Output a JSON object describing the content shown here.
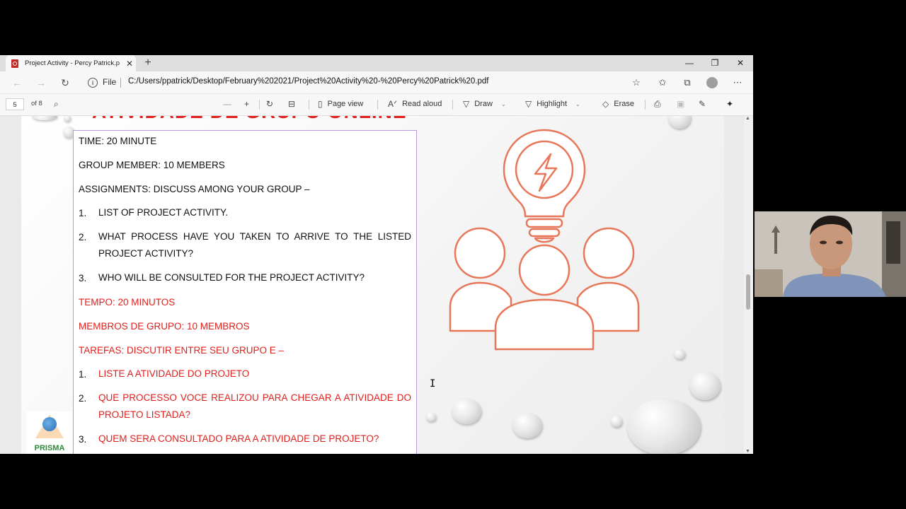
{
  "browser": {
    "tab_title": "Project Activity - Percy Patrick.p",
    "file_label": "File",
    "url": "C:/Users/ppatrick/Desktop/February%202021/Project%20Activity%20-%20Percy%20Patrick%20.pdf"
  },
  "pdf_toolbar": {
    "page_number": "5",
    "page_of": "of 8",
    "page_view": "Page view",
    "read_aloud": "Read aloud",
    "draw": "Draw",
    "highlight": "Highlight",
    "erase": "Erase"
  },
  "document": {
    "heading": "ATIVIDADE DE GRUPO ONLINE",
    "english": {
      "time": "TIME: 20 MINUTE",
      "group": "GROUP MEMBER: 10 MEMBERS",
      "assignments": "ASSIGNMENTS: DISCUSS AMONG YOUR GROUP –",
      "items": [
        {
          "num": "1.",
          "text": "LIST OF PROJECT ACTIVITY."
        },
        {
          "num": "2.",
          "text": "WHAT PROCESS HAVE YOU TAKEN TO ARRIVE TO THE LISTED PROJECT ACTIVITY?"
        },
        {
          "num": "3.",
          "text": "WHO WILL BE CONSULTED FOR THE PROJECT ACTIVITY?"
        }
      ]
    },
    "portuguese": {
      "time": "TEMPO: 20 MINUTOS",
      "group": "MEMBROS DE GRUPO: 10 MEMBROS",
      "assignments": "TAREFAS: DISCUTIR ENTRE SEU GRUPO E –",
      "items": [
        {
          "num": "1.",
          "text": "LISTE A ATIVIDADE DO PROJETO"
        },
        {
          "num": "2.",
          "text": "QUE PROCESSO VOCE REALIZOU PARA CHEGAR A ATIVIDADE DO PROJETO LISTADA?"
        },
        {
          "num": "3.",
          "text": "QUEM SERA CONSULTADO PARA A ATIVIDADE DE PROJETO?"
        }
      ]
    },
    "logo_text": "PRISMA"
  },
  "colors": {
    "accent_red": "#e0201c",
    "illustration_stroke": "#e8775a"
  }
}
